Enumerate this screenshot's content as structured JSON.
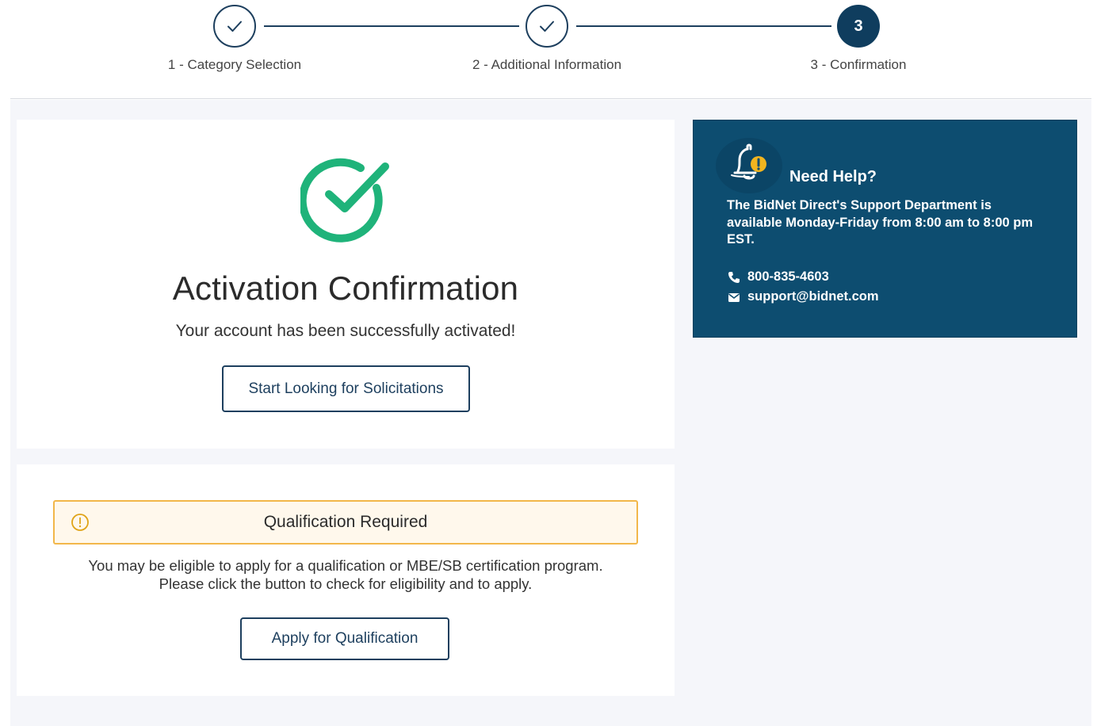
{
  "stepper": {
    "steps": [
      {
        "label": "1 - Category Selection",
        "status": "complete"
      },
      {
        "label": "2 - Additional Information",
        "status": "complete"
      },
      {
        "label": "3 - Confirmation",
        "status": "active",
        "number": "3"
      }
    ]
  },
  "activation": {
    "title": "Activation Confirmation",
    "subtitle": "Your account has been successfully activated!",
    "button_label": "Start Looking for Solicitations"
  },
  "qualification": {
    "alert_title": "Qualification Required",
    "description_line1": "You may be eligible to apply for a qualification or MBE/SB certification program.",
    "description_line2": "Please click the button to check for eligibility and to apply.",
    "button_label": "Apply for Qualification"
  },
  "help": {
    "title": "Need Help?",
    "text": "The BidNet Direct's Support Department is available Monday-Friday from 8:00 am to 8:00 pm EST.",
    "phone": "800-835-4603",
    "email": "support@bidnet.com"
  },
  "colors": {
    "primary": "#0f3d5e",
    "success": "#1fb37a",
    "warning": "#f2b74a",
    "help_bg": "#0d4d70",
    "page_bg": "#f5f6fa"
  }
}
